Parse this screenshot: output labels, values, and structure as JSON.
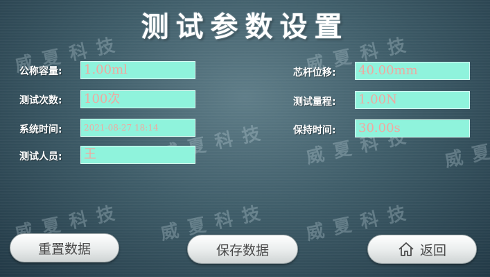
{
  "title": "测试参数设置",
  "watermark": "威夏科技",
  "left_fields": [
    {
      "label": "公称容量:",
      "value": "1.00ml"
    },
    {
      "label": "测试次数:",
      "value": "100次"
    },
    {
      "label": "系统时间:",
      "value": "2021-08-27 18:14"
    },
    {
      "label": "测试人员:",
      "value": "王"
    }
  ],
  "right_fields": [
    {
      "label": "芯杆位移:",
      "value": "40.00mm"
    },
    {
      "label": "测试量程:",
      "value": "1.00N"
    },
    {
      "label": "保持时间:",
      "value": "30.00s"
    }
  ],
  "buttons": {
    "reset": "重置数据",
    "save": "保存数据",
    "back": "返回",
    "back_icon": "home-icon"
  },
  "colors": {
    "field_bg": "#8ff3dc",
    "field_text": "#f0a8a0",
    "background": "#3f5d69"
  }
}
